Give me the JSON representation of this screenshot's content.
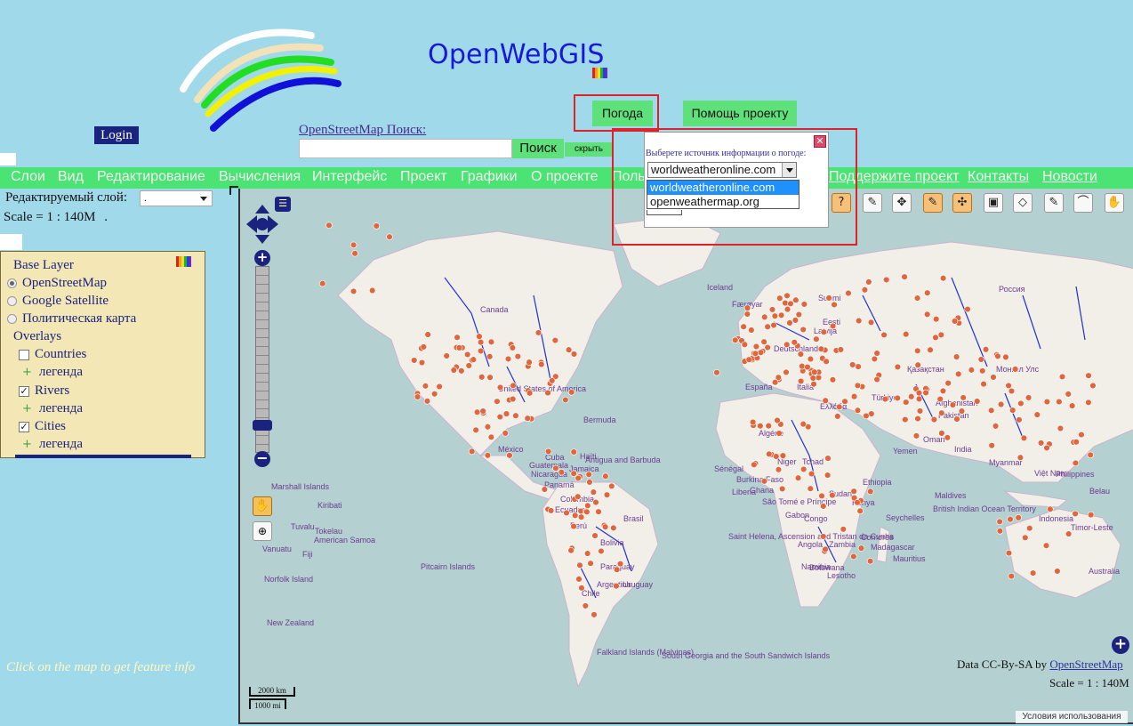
{
  "app": {
    "title": "OpenWebGIS",
    "login_label": "Login"
  },
  "search": {
    "osm_link": "OpenStreetMap  Поиск:",
    "value": "",
    "button": "Поиск",
    "hide_button": "скрыть"
  },
  "top_buttons": {
    "weather": "Погода",
    "help": "Помощь проекту"
  },
  "menu": {
    "items": [
      "Слои",
      "Вид",
      "Редактирование",
      "Вычисления",
      "Интерфейс",
      "Проект",
      "Графики",
      "О проекте",
      "Поль",
      "Поддержите проект",
      "Контакты",
      "Новости"
    ]
  },
  "left": {
    "edit_layer_label": "Редактируемый слой:",
    "edit_layer_value": ".",
    "scale_text": "Scale = 1 : 140M",
    "scale_dot": ".",
    "feature_info": "Click on the map to get feature info"
  },
  "layers": {
    "base_title": "Base Layer",
    "base": [
      {
        "label": "OpenStreetMap",
        "selected": true
      },
      {
        "label": "Google Satellite",
        "selected": false
      },
      {
        "label": "Политическая карта",
        "selected": false
      }
    ],
    "overlays_title": "Overlays",
    "overlays": [
      {
        "label": "Countries",
        "checked": false,
        "legend": "легенда"
      },
      {
        "label": "Rivers",
        "checked": true,
        "legend": "легенда"
      },
      {
        "label": "Cities",
        "checked": true,
        "legend": "легенда"
      }
    ]
  },
  "weather_popup": {
    "label": "Выберете источник информации о погоде:",
    "selected": "worldweatheronline.com",
    "options": [
      "worldweatheronline.com",
      "openweathermap.org"
    ]
  },
  "map": {
    "attribution_prefix": "Data CC-By-SA by ",
    "attribution_link": "OpenStreetMap",
    "scale_text": "Scale = 1 : 140M",
    "terms": "Условия использования",
    "scalebar_km": "2000 km",
    "scalebar_mi": "1000 mi",
    "labels": [
      "Iceland",
      "Canada",
      "Færøyar",
      "Suomi",
      "Россия",
      "Latvija",
      "Deutschland",
      "Eesti",
      "Қазақстан",
      "Монгол Улс",
      "United States of America",
      "Bermuda",
      "Antigua and Barbuda",
      "Algérie",
      "Tchad",
      "Niger",
      "Sudan",
      "Kenya",
      "Ethiopia",
      "India",
      "Philippines",
      "Indonesia",
      "Timor-Leste",
      "Australia",
      "New Zealand",
      "Marshall Islands",
      "Kiribati",
      "Tuvalu",
      "Tokelau",
      "American Samoa",
      "Vanuatu",
      "Fiji",
      "Norfolk Island",
      "Pitcairn Islands",
      "Falkland Islands (Malvinas)",
      "South Georgia and the South Sandwich Islands",
      "Saint Helena, Ascension and Tristan da Cunha",
      "Seychelles",
      "Comores",
      "Mauritius",
      "Botswana",
      "Lesotho",
      "Maldives",
      "British Indian Ocean Territory",
      "Belau",
      "Myanmar",
      "Việt Nam",
      "Guatemala",
      "Nicaragua",
      "Panamá",
      "Colombia",
      "Ecuador",
      "Perú",
      "Brasil",
      "Bolivia",
      "Paraguay",
      "Chile",
      "Argentina",
      "Uruguay",
      "México",
      "Cuba",
      "Jamaica",
      "Haïti",
      "Sénégal",
      "Ghana",
      "Burkina Faso",
      "Liberia",
      "São Tomé e Príncipe",
      "Gabon",
      "Congo",
      "Angola",
      "Zambia",
      "Namibia",
      "Madagascar",
      "Yemen",
      "Oman",
      "Pakistan",
      "Afghanistan",
      "Türkiye",
      "España",
      "Italia",
      "Ελλάδα"
    ]
  },
  "colors": {
    "page_bg": "#9fd9ea",
    "menu_green": "#4be474",
    "button_green": "#5ee07a",
    "dark_blue": "#1a237e",
    "highlight_red": "#e0202a"
  }
}
